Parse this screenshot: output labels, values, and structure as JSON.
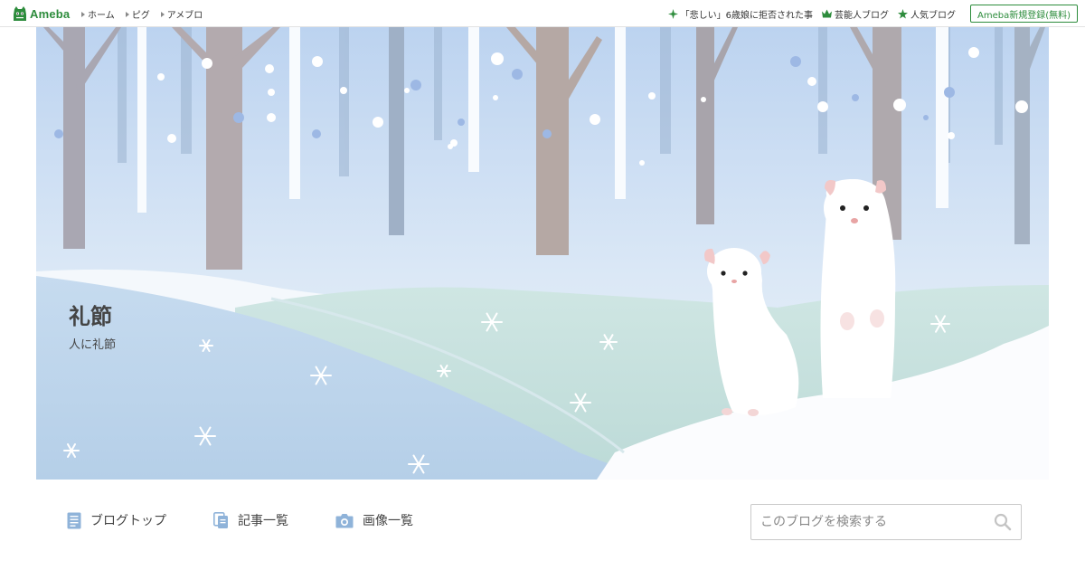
{
  "header": {
    "logo_text": "Ameba",
    "nav": [
      {
        "label": "ホーム"
      },
      {
        "label": "ピグ"
      },
      {
        "label": "アメブロ"
      }
    ],
    "right_links": [
      {
        "icon": "sparkle-icon",
        "label": "「悲しい」6歳娘に拒否された事"
      },
      {
        "icon": "crown-icon",
        "label": "芸能人ブログ"
      },
      {
        "icon": "star-icon",
        "label": "人気ブログ"
      }
    ],
    "register_label": "Ameba新規登録(無料)"
  },
  "hero": {
    "title": "礼節",
    "description": "人に礼節"
  },
  "menu": {
    "items": [
      {
        "icon": "document-icon",
        "label": "ブログトップ"
      },
      {
        "icon": "pages-icon",
        "label": "記事一覧"
      },
      {
        "icon": "camera-icon",
        "label": "画像一覧"
      }
    ]
  },
  "search": {
    "placeholder": "このブログを検索する",
    "value": ""
  },
  "colors": {
    "brand_green": "#2d8c3c",
    "icon_blue": "#8fb3d9"
  }
}
